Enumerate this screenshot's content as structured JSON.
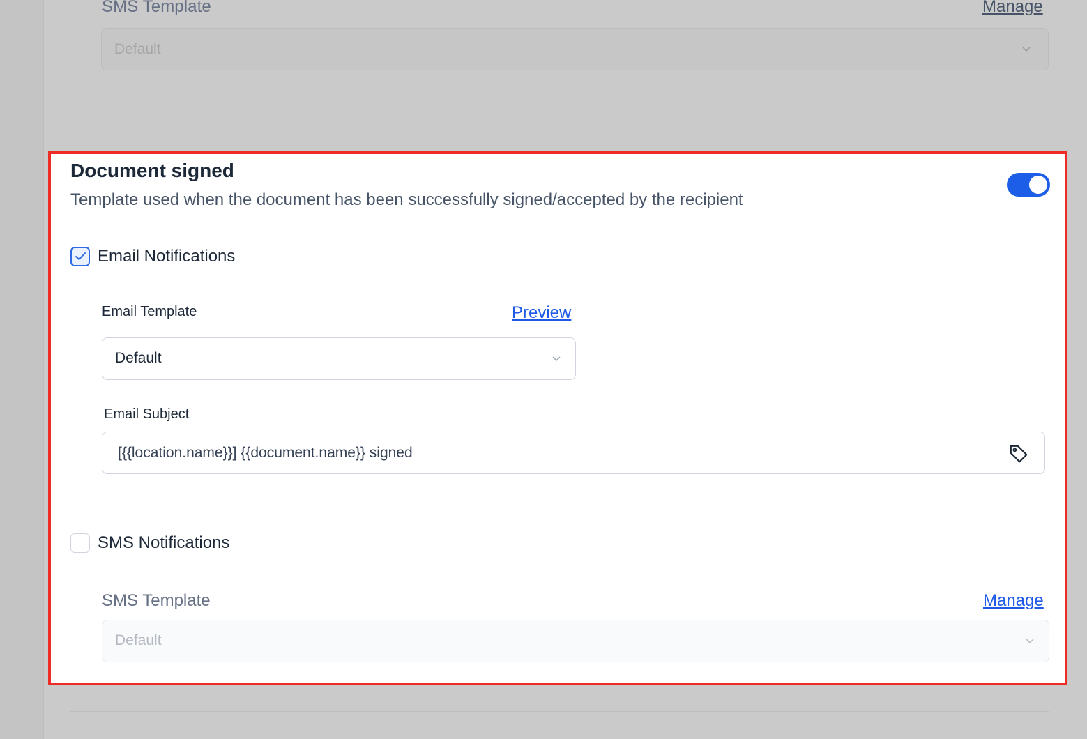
{
  "background_section": {
    "sms_template_label": "SMS Template",
    "manage_link": "Manage",
    "sms_template_value": "Default"
  },
  "document_signed": {
    "title": "Document signed",
    "description": "Template used when the document has been successfully signed/accepted by the recipient",
    "enabled": true,
    "email_notifications": {
      "label": "Email Notifications",
      "checked": true,
      "email_template_label": "Email Template",
      "preview_link": "Preview",
      "email_template_value": "Default",
      "email_subject_label": "Email Subject",
      "email_subject_value": "[{{location.name}}] {{document.name}} signed"
    },
    "sms_notifications": {
      "label": "SMS Notifications",
      "checked": false,
      "sms_template_label": "SMS Template",
      "manage_link": "Manage",
      "sms_template_value": "Default"
    }
  },
  "colors": {
    "accent": "#1d5ee8",
    "link": "#1f5ae6",
    "highlight_border": "#ee2b24"
  },
  "icons": {
    "tag": "tag-icon",
    "chevron": "chevron-down-icon",
    "check": "check-icon"
  }
}
